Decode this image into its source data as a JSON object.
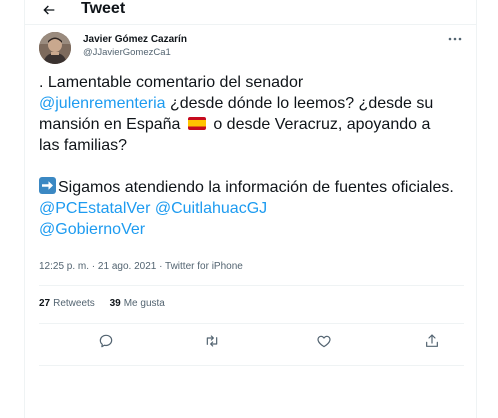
{
  "header": {
    "title": "Tweet"
  },
  "author": {
    "name": "Javier Gómez Cazarín",
    "handle": "@JJavierGomezCa1"
  },
  "tweet": {
    "line1_prefix": ". Lamentable comentario del senador",
    "mention1": "@julenrementeria",
    "line2_suffix": " ¿desde dónde lo leemos? ¿desde su",
    "line3_prefix": "mansión en España ",
    "line3_suffix": " o desde Veracruz, apoyando a",
    "line4": "las familias?",
    "para2_text": "Sigamos atendiendo la información de fuentes oficiales. ",
    "mention2": "@PCEstatalVer",
    "mention3": "@CuitlahuacGJ",
    "mention4": "@GobiernoVer"
  },
  "meta": {
    "time": "12:25 p. m.",
    "separator": " · ",
    "date": "21 ago. 2021",
    "source": "Twitter for iPhone"
  },
  "stats": {
    "retweets_count": "27",
    "retweets_label": "Retweets",
    "likes_count": "39",
    "likes_label": "Me gusta"
  },
  "icons": {
    "back": "arrow-left-icon",
    "more": "more-horizontal-icon",
    "reply": "reply-icon",
    "retweet": "retweet-icon",
    "like": "heart-icon",
    "share": "share-icon"
  },
  "colors": {
    "link": "#1d9bf0",
    "text": "#0f1419",
    "secondary": "#536471",
    "border": "#eff3f4"
  }
}
